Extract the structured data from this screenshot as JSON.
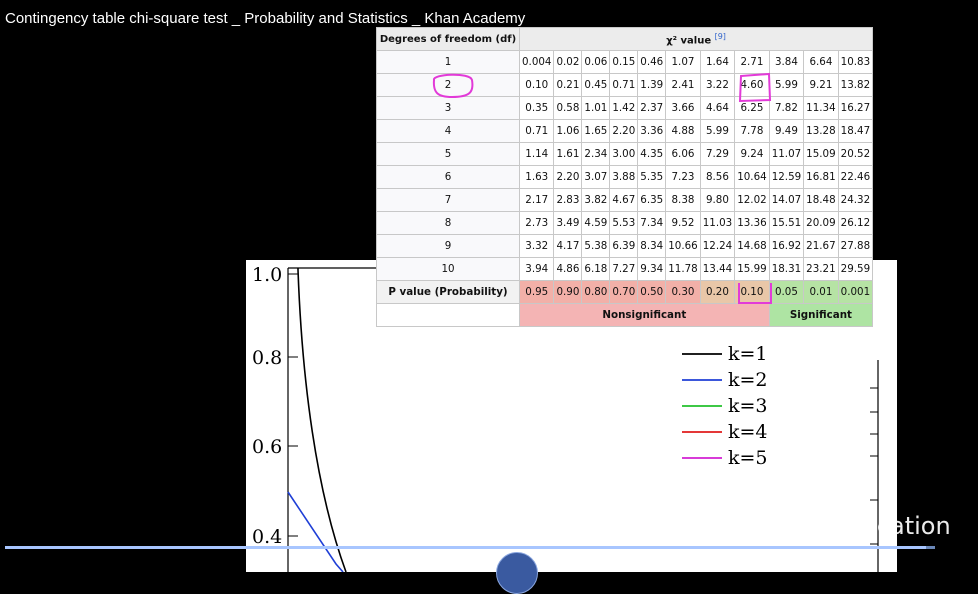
{
  "window": {
    "title": "Contingency table chi-square test _ Probability and Statistics _ Khan Academy"
  },
  "table": {
    "header_df": "Degrees of freedom (df)",
    "header_x2": "χ² value",
    "header_ref": "[9]",
    "rows": [
      {
        "df": "1",
        "values": [
          "0.004",
          "0.02",
          "0.06",
          "0.15",
          "0.46",
          "1.07",
          "1.64",
          "2.71",
          "3.84",
          "6.64",
          "10.83"
        ]
      },
      {
        "df": "2",
        "values": [
          "0.10",
          "0.21",
          "0.45",
          "0.71",
          "1.39",
          "2.41",
          "3.22",
          "4.60",
          "5.99",
          "9.21",
          "13.82"
        ]
      },
      {
        "df": "3",
        "values": [
          "0.35",
          "0.58",
          "1.01",
          "1.42",
          "2.37",
          "3.66",
          "4.64",
          "6.25",
          "7.82",
          "11.34",
          "16.27"
        ]
      },
      {
        "df": "4",
        "values": [
          "0.71",
          "1.06",
          "1.65",
          "2.20",
          "3.36",
          "4.88",
          "5.99",
          "7.78",
          "9.49",
          "13.28",
          "18.47"
        ]
      },
      {
        "df": "5",
        "values": [
          "1.14",
          "1.61",
          "2.34",
          "3.00",
          "4.35",
          "6.06",
          "7.29",
          "9.24",
          "11.07",
          "15.09",
          "20.52"
        ]
      },
      {
        "df": "6",
        "values": [
          "1.63",
          "2.20",
          "3.07",
          "3.88",
          "5.35",
          "7.23",
          "8.56",
          "10.64",
          "12.59",
          "16.81",
          "22.46"
        ]
      },
      {
        "df": "7",
        "values": [
          "2.17",
          "2.83",
          "3.82",
          "4.67",
          "6.35",
          "8.38",
          "9.80",
          "12.02",
          "14.07",
          "18.48",
          "24.32"
        ]
      },
      {
        "df": "8",
        "values": [
          "2.73",
          "3.49",
          "4.59",
          "5.53",
          "7.34",
          "9.52",
          "11.03",
          "13.36",
          "15.51",
          "20.09",
          "26.12"
        ]
      },
      {
        "df": "9",
        "values": [
          "3.32",
          "4.17",
          "5.38",
          "6.39",
          "8.34",
          "10.66",
          "12.24",
          "14.68",
          "16.92",
          "21.67",
          "27.88"
        ]
      },
      {
        "df": "10",
        "values": [
          "3.94",
          "4.86",
          "6.18",
          "7.27",
          "9.34",
          "11.78",
          "13.44",
          "15.99",
          "18.31",
          "23.21",
          "29.59"
        ]
      }
    ],
    "p_label": "P value (Probability)",
    "p_values": [
      "0.95",
      "0.90",
      "0.80",
      "0.70",
      "0.50",
      "0.30",
      "0.20",
      "0.10",
      "0.05",
      "0.01",
      "0.001"
    ],
    "nonsignificant_label": "Nonsignificant",
    "significant_label": "Significant"
  },
  "chart": {
    "y_ticks": [
      "1.0",
      "0.8",
      "0.6",
      "0.4"
    ],
    "legend": [
      "k=1",
      "k=2",
      "k=3",
      "k=4",
      "k=5"
    ],
    "colors": {
      "k=1": "#000000",
      "k=2": "#1f3fd6",
      "k=3": "#22c02c",
      "k=4": "#e01b1b",
      "k=5": "#d21fd2"
    }
  },
  "watermark": {
    "text": "PythonEducation"
  },
  "player": {
    "progress_fraction": 0.99
  }
}
